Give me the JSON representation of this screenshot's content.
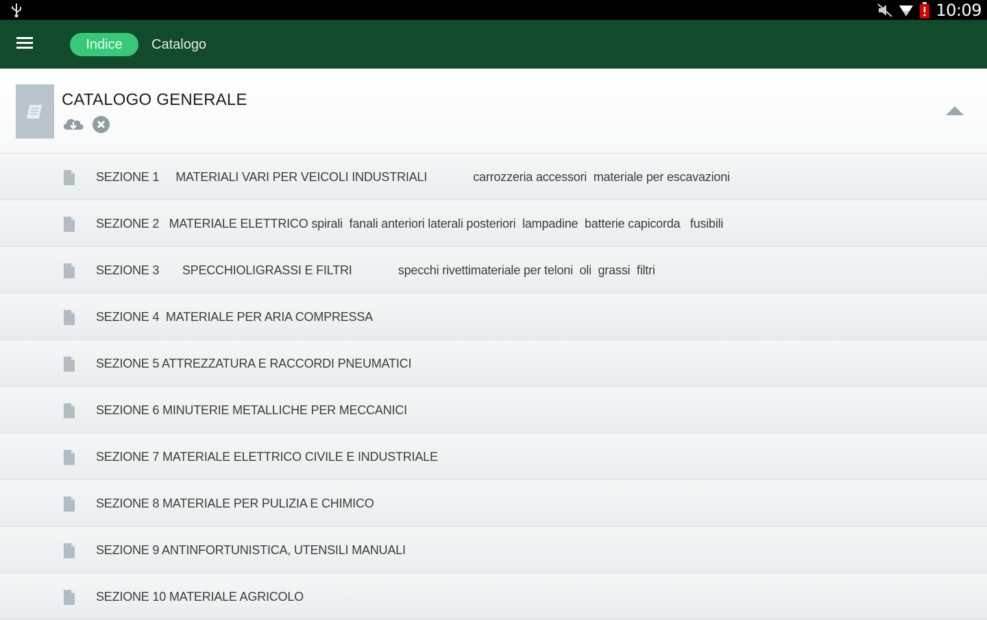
{
  "status_bar": {
    "time": "10:09",
    "icons": [
      "usb-icon",
      "mute-icon",
      "wifi-icon",
      "battery-low-icon"
    ]
  },
  "app_bar": {
    "menu_icon": "hamburger-menu-icon",
    "tabs": [
      {
        "label": "Indice",
        "active": true
      },
      {
        "label": "Catalogo",
        "active": false
      }
    ],
    "colors": {
      "bar": "#124a2c",
      "active_tab": "#37c978"
    }
  },
  "catalog": {
    "title": "CATALOGO GENERALE",
    "icons": [
      "book-icon",
      "cloud-download-icon",
      "cancel-circle-icon",
      "collapse-up-icon"
    ]
  },
  "sections": [
    {
      "label": "SEZIONE 1     MATERIALI VARI PER VEICOLI INDUSTRIALI              carrozzeria accessori  materiale per escavazioni"
    },
    {
      "label": "SEZIONE 2   MATERIALE ELETTRICO spirali  fanali anteriori laterali posteriori  lampadine  batterie capicorda   fusibili"
    },
    {
      "label": "SEZIONE 3       SPECCHIOLIGRASSI E FILTRI              specchi rivettimateriale per teloni  oli  grassi  filtri"
    },
    {
      "label": "SEZIONE 4  MATERIALE PER ARIA COMPRESSA"
    },
    {
      "label": "SEZIONE 5 ATTREZZATURA E RACCORDI PNEUMATICI"
    },
    {
      "label": "SEZIONE 6 MINUTERIE METALLICHE PER MECCANICI"
    },
    {
      "label": "SEZIONE 7 MATERIALE ELETTRICO CIVILE E INDUSTRIALE"
    },
    {
      "label": "SEZIONE 8 MATERIALE PER PULIZIA E CHIMICO"
    },
    {
      "label": "SEZIONE 9 ANTINFORTUNISTICA, UTENSILI MANUALI"
    },
    {
      "label": "SEZIONE 10 MATERIALE AGRICOLO"
    }
  ]
}
